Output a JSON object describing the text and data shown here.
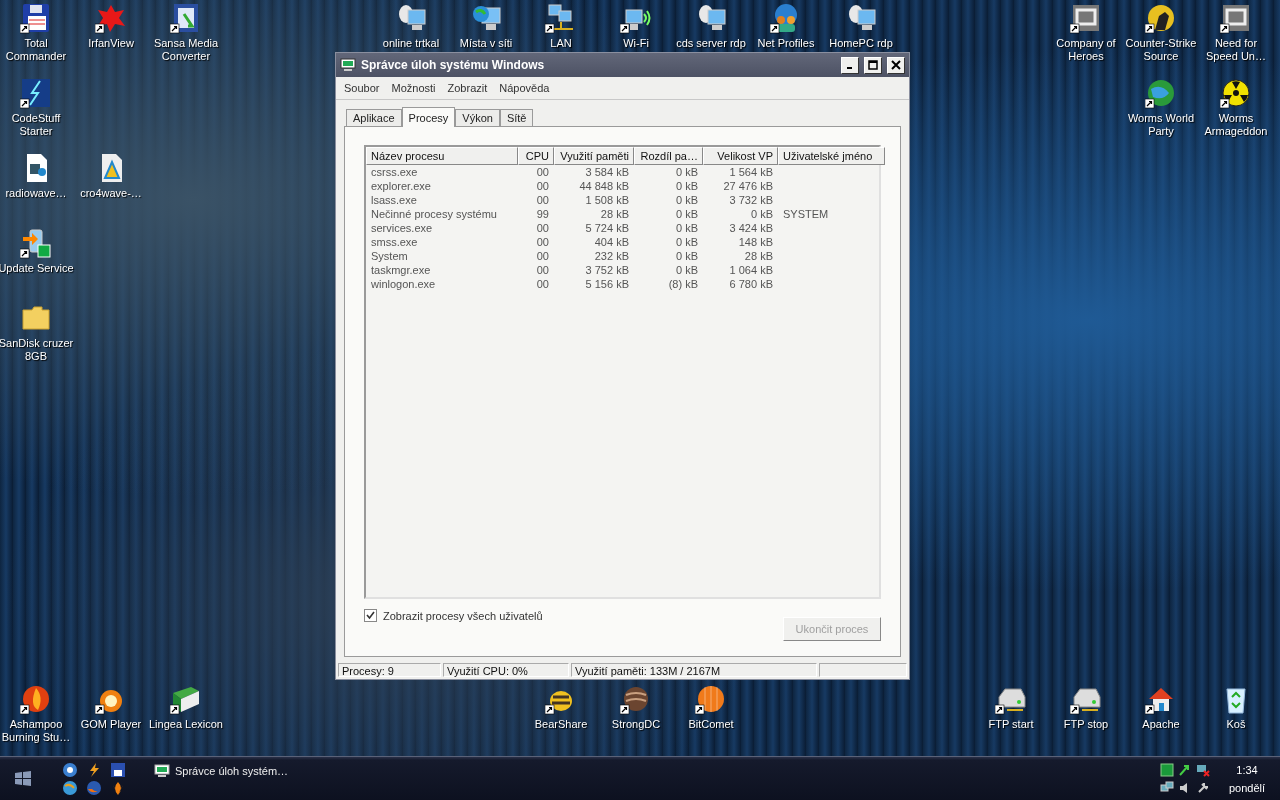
{
  "desktop_icons": [
    {
      "label": "Total Commander"
    },
    {
      "label": "IrfanView"
    },
    {
      "label": "Sansa Media Converter"
    },
    {
      "label": "online trtkal"
    },
    {
      "label": "Místa v síti"
    },
    {
      "label": "LAN"
    },
    {
      "label": "Wi-Fi"
    },
    {
      "label": "cds server rdp"
    },
    {
      "label": "Net Profiles"
    },
    {
      "label": "HomePC rdp"
    },
    {
      "label": "Company of Heroes"
    },
    {
      "label": "Counter-Strike Source"
    },
    {
      "label": "Need for Speed Un…"
    },
    {
      "label": "CodeStuff Starter"
    },
    {
      "label": "Worms World Party"
    },
    {
      "label": "Worms Armageddon"
    },
    {
      "label": "radiowave…"
    },
    {
      "label": "cro4wave-…"
    },
    {
      "label": "Update Service"
    },
    {
      "label": "SanDisk cruzer 8GB"
    },
    {
      "label": "Ashampoo Burning Stu…"
    },
    {
      "label": "GOM Player"
    },
    {
      "label": "Lingea Lexicon"
    },
    {
      "label": "BearShare"
    },
    {
      "label": "StrongDC"
    },
    {
      "label": "BitComet"
    },
    {
      "label": "FTP start"
    },
    {
      "label": "FTP stop"
    },
    {
      "label": "Apache"
    },
    {
      "label": "Koš"
    }
  ],
  "window": {
    "title": "Správce úloh systému Windows",
    "menu": [
      "Soubor",
      "Možnosti",
      "Zobrazit",
      "Nápověda"
    ],
    "tabs": [
      {
        "label": "Aplikace",
        "selected": false
      },
      {
        "label": "Procesy",
        "selected": true
      },
      {
        "label": "Výkon",
        "selected": false
      },
      {
        "label": "Sítě",
        "selected": false
      }
    ],
    "table": {
      "columns": [
        "Název procesu",
        "CPU",
        "Využití paměti",
        "Rozdíl pa…",
        "Velikost VP",
        "Uživatelské jméno"
      ],
      "rows": [
        [
          "csrss.exe",
          "00",
          "3 584 kB",
          "0 kB",
          "1 564 kB",
          ""
        ],
        [
          "explorer.exe",
          "00",
          "44 848 kB",
          "0 kB",
          "27 476 kB",
          ""
        ],
        [
          "lsass.exe",
          "00",
          "1 508 kB",
          "0 kB",
          "3 732 kB",
          ""
        ],
        [
          "Nečinné procesy systému",
          "99",
          "28 kB",
          "0 kB",
          "0 kB",
          "SYSTEM"
        ],
        [
          "services.exe",
          "00",
          "5 724 kB",
          "0 kB",
          "3 424 kB",
          ""
        ],
        [
          "smss.exe",
          "00",
          "404 kB",
          "0 kB",
          "148 kB",
          ""
        ],
        [
          "System",
          "00",
          "232 kB",
          "0 kB",
          "28 kB",
          ""
        ],
        [
          "taskmgr.exe",
          "00",
          "3 752 kB",
          "0 kB",
          "1 064 kB",
          ""
        ],
        [
          "winlogon.exe",
          "00",
          "5 156 kB",
          "(8) kB",
          "6 780 kB",
          ""
        ]
      ]
    },
    "show_all_users": {
      "label": "Zobrazit procesy všech uživatelů",
      "checked": true
    },
    "end_button": {
      "label": "Ukončit proces",
      "disabled": true
    },
    "status_bar": [
      "Procesy: 9",
      "Využití CPU: 0%",
      "Využití paměti: 133M / 2167M"
    ]
  },
  "taskbar": {
    "task": "Správce úloh systém…",
    "clock": "1:34",
    "day": "pondělí"
  }
}
